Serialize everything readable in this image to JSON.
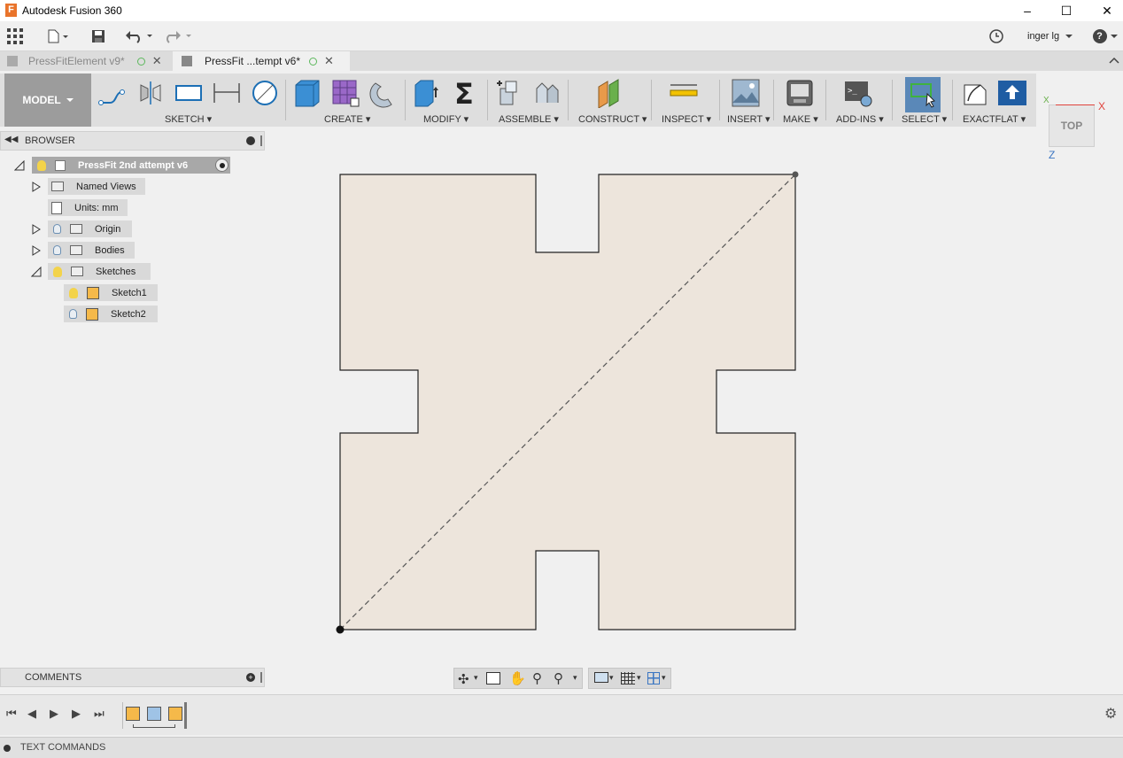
{
  "app": {
    "title": "Autodesk Fusion 360",
    "icon": "F"
  },
  "window_controls": [
    "minimize-icon",
    "maximize-icon",
    "close-icon"
  ],
  "qat": {
    "user": "inger lg",
    "help": "?"
  },
  "tabs": [
    {
      "label": "PressFitElement v9*",
      "active": false
    },
    {
      "label": "PressFit ...tempt v6*",
      "active": true
    }
  ],
  "ribbon": {
    "model_label": "MODEL",
    "groups": [
      {
        "label": "SKETCH"
      },
      {
        "label": "CREATE"
      },
      {
        "label": "MODIFY"
      },
      {
        "label": "ASSEMBLE"
      },
      {
        "label": "CONSTRUCT"
      },
      {
        "label": "INSPECT"
      },
      {
        "label": "INSERT"
      },
      {
        "label": "MAKE"
      },
      {
        "label": "ADD-INS"
      },
      {
        "label": "SELECT"
      },
      {
        "label": "EXACTFLAT"
      }
    ]
  },
  "browser": {
    "title": "BROWSER",
    "root": "PressFit 2nd attempt v6",
    "items": [
      {
        "label": "Named Views"
      },
      {
        "label": "Units: mm"
      },
      {
        "label": "Origin"
      },
      {
        "label": "Bodies"
      },
      {
        "label": "Sketches"
      },
      {
        "label": "Sketch1"
      },
      {
        "label": "Sketch2"
      }
    ]
  },
  "comments": {
    "title": "COMMENTS"
  },
  "viewcube": {
    "face": "TOP",
    "axis_x": "X",
    "axis_z": "Z"
  },
  "text_commands": {
    "title": "TEXT COMMANDS"
  },
  "colors": {
    "sketch_fill": "#ede5dc",
    "select_active": "#5a88b8",
    "model_bg": "#9c9c9c"
  }
}
